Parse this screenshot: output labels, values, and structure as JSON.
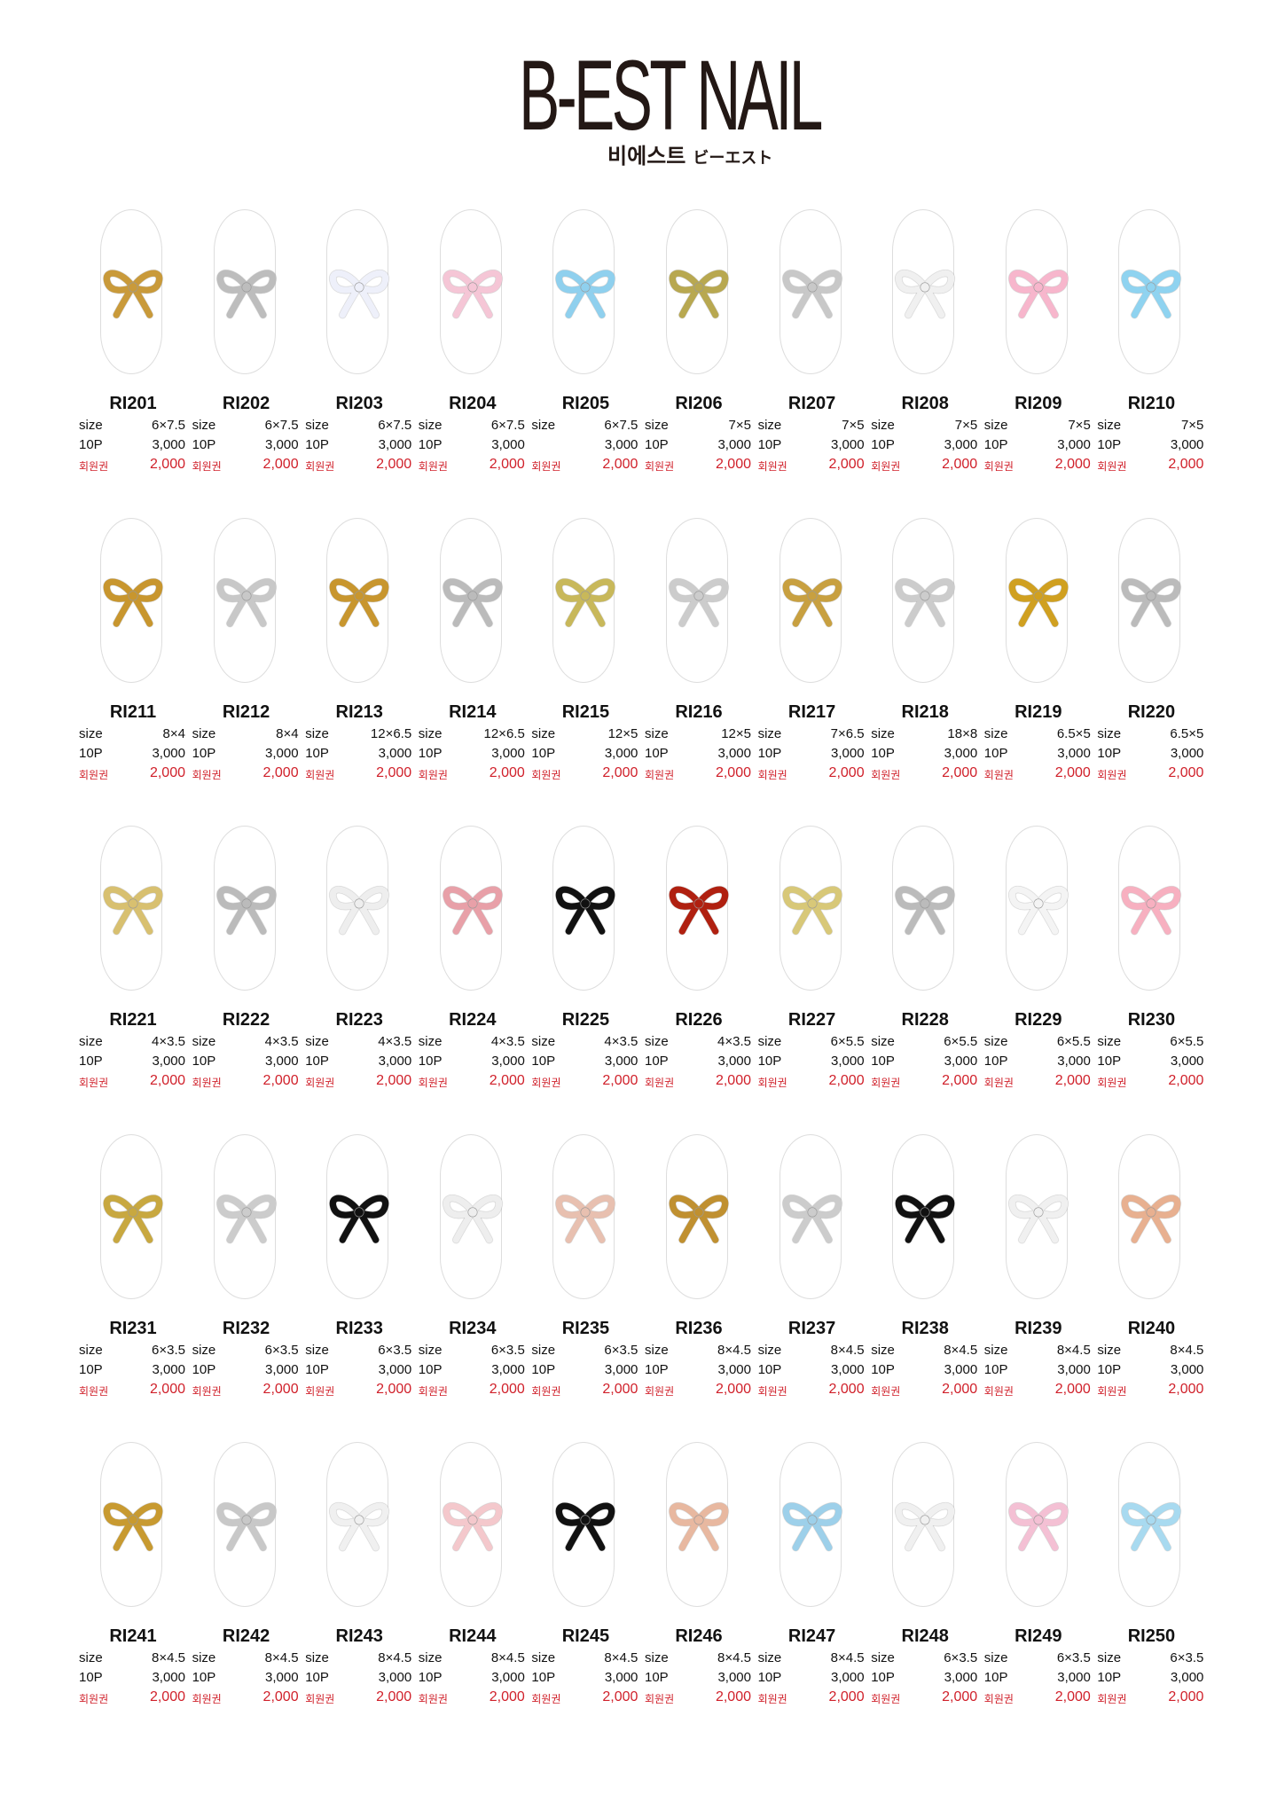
{
  "brand": {
    "name": "B-EST NAIL",
    "subtitle_ko": "비에스트",
    "subtitle_jp": "ビーエスト"
  },
  "labels": {
    "size": "size",
    "qty": "10P",
    "member": "회원권"
  },
  "items": [
    {
      "code": "RI201",
      "size": "6×7.5",
      "qty": "10P",
      "price": "3,000",
      "member_price": "2,000",
      "color": "#c99a3a"
    },
    {
      "code": "RI202",
      "size": "6×7.5",
      "qty": "10P",
      "price": "3,000",
      "member_price": "2,000",
      "color": "#bdbdbd"
    },
    {
      "code": "RI203",
      "size": "6×7.5",
      "qty": "10P",
      "price": "3,000",
      "member_price": "2,000",
      "color": "#eef0fa"
    },
    {
      "code": "RI204",
      "size": "6×7.5",
      "qty": "10P",
      "price": "3,000",
      "member_price": "2,000",
      "color": "#f5c6d6"
    },
    {
      "code": "RI205",
      "size": "6×7.5",
      "qty": "",
      "price": "3,000",
      "member_price": "2,000",
      "color": "#8fd0ee"
    },
    {
      "code": "RI206",
      "size": "7×5",
      "qty": "10P",
      "price": "3,000",
      "member_price": "2,000",
      "color": "#b8a850"
    },
    {
      "code": "RI207",
      "size": "7×5",
      "qty": "10P",
      "price": "3,000",
      "member_price": "2,000",
      "color": "#c8c8c8"
    },
    {
      "code": "RI208",
      "size": "7×5",
      "qty": "10P",
      "price": "3,000",
      "member_price": "2,000",
      "color": "#f0f0f0"
    },
    {
      "code": "RI209",
      "size": "7×5",
      "qty": "10P",
      "price": "3,000",
      "member_price": "2,000",
      "color": "#f7b6cc"
    },
    {
      "code": "RI210",
      "size": "7×5",
      "qty": "10P",
      "price": "3,000",
      "member_price": "2,000",
      "color": "#8fd3f0"
    },
    {
      "code": "RI211",
      "size": "8×4",
      "qty": "10P",
      "price": "3,000",
      "member_price": "2,000",
      "color": "#c8962e"
    },
    {
      "code": "RI212",
      "size": "8×4",
      "qty": "10P",
      "price": "3,000",
      "member_price": "2,000",
      "color": "#c8c8c8"
    },
    {
      "code": "RI213",
      "size": "12×6.5",
      "qty": "10P",
      "price": "3,000",
      "member_price": "2,000",
      "color": "#c8962e"
    },
    {
      "code": "RI214",
      "size": "12×6.5",
      "qty": "10P",
      "price": "3,000",
      "member_price": "2,000",
      "color": "#bbbbbb"
    },
    {
      "code": "RI215",
      "size": "12×5",
      "qty": "10P",
      "price": "3,000",
      "member_price": "2,000",
      "color": "#c8b85a"
    },
    {
      "code": "RI216",
      "size": "12×5",
      "qty": "10P",
      "price": "3,000",
      "member_price": "2,000",
      "color": "#cccccc"
    },
    {
      "code": "RI217",
      "size": "7×6.5",
      "qty": "10P",
      "price": "3,000",
      "member_price": "2,000",
      "color": "#c8a040"
    },
    {
      "code": "RI218",
      "size": "18×8",
      "qty": "10P",
      "price": "3,000",
      "member_price": "2,000",
      "color": "#cccccc"
    },
    {
      "code": "RI219",
      "size": "6.5×5",
      "qty": "10P",
      "price": "3,000",
      "member_price": "2,000",
      "color": "#d0a020"
    },
    {
      "code": "RI220",
      "size": "6.5×5",
      "qty": "10P",
      "price": "3,000",
      "member_price": "2,000",
      "color": "#bbbbbb"
    },
    {
      "code": "RI221",
      "size": "4×3.5",
      "qty": "10P",
      "price": "3,000",
      "member_price": "2,000",
      "color": "#d8c070"
    },
    {
      "code": "RI222",
      "size": "4×3.5",
      "qty": "10P",
      "price": "3,000",
      "member_price": "2,000",
      "color": "#bbbbbb"
    },
    {
      "code": "RI223",
      "size": "4×3.5",
      "qty": "10P",
      "price": "3,000",
      "member_price": "2,000",
      "color": "#eeeeee"
    },
    {
      "code": "RI224",
      "size": "4×3.5",
      "qty": "10P",
      "price": "3,000",
      "member_price": "2,000",
      "color": "#e8a0a8"
    },
    {
      "code": "RI225",
      "size": "4×3.5",
      "qty": "10P",
      "price": "3,000",
      "member_price": "2,000",
      "color": "#111111"
    },
    {
      "code": "RI226",
      "size": "4×3.5",
      "qty": "10P",
      "price": "3,000",
      "member_price": "2,000",
      "color": "#b02010"
    },
    {
      "code": "RI227",
      "size": "6×5.5",
      "qty": "10P",
      "price": "3,000",
      "member_price": "2,000",
      "color": "#d8c878"
    },
    {
      "code": "RI228",
      "size": "6×5.5",
      "qty": "10P",
      "price": "3,000",
      "member_price": "2,000",
      "color": "#bbbbbb"
    },
    {
      "code": "RI229",
      "size": "6×5.5",
      "qty": "10P",
      "price": "3,000",
      "member_price": "2,000",
      "color": "#f4f4f4"
    },
    {
      "code": "RI230",
      "size": "6×5.5",
      "qty": "10P",
      "price": "3,000",
      "member_price": "2,000",
      "color": "#f7b0c0"
    },
    {
      "code": "RI231",
      "size": "6×3.5",
      "qty": "10P",
      "price": "3,000",
      "member_price": "2,000",
      "color": "#c8a840"
    },
    {
      "code": "RI232",
      "size": "6×3.5",
      "qty": "10P",
      "price": "3,000",
      "member_price": "2,000",
      "color": "#cccccc"
    },
    {
      "code": "RI233",
      "size": "6×3.5",
      "qty": "10P",
      "price": "3,000",
      "member_price": "2,000",
      "color": "#111111"
    },
    {
      "code": "RI234",
      "size": "6×3.5",
      "qty": "10P",
      "price": "3,000",
      "member_price": "2,000",
      "color": "#eeeeee"
    },
    {
      "code": "RI235",
      "size": "6×3.5",
      "qty": "10P",
      "price": "3,000",
      "member_price": "2,000",
      "color": "#e8c0b0"
    },
    {
      "code": "RI236",
      "size": "8×4.5",
      "qty": "10P",
      "price": "3,000",
      "member_price": "2,000",
      "color": "#c09030"
    },
    {
      "code": "RI237",
      "size": "8×4.5",
      "qty": "10P",
      "price": "3,000",
      "member_price": "2,000",
      "color": "#cccccc"
    },
    {
      "code": "RI238",
      "size": "8×4.5",
      "qty": "10P",
      "price": "3,000",
      "member_price": "2,000",
      "color": "#111111"
    },
    {
      "code": "RI239",
      "size": "8×4.5",
      "qty": "10P",
      "price": "3,000",
      "member_price": "2,000",
      "color": "#f0f0f0"
    },
    {
      "code": "RI240",
      "size": "8×4.5",
      "qty": "10P",
      "price": "3,000",
      "member_price": "2,000",
      "color": "#e8b090"
    },
    {
      "code": "RI241",
      "size": "8×4.5",
      "qty": "10P",
      "price": "3,000",
      "member_price": "2,000",
      "color": "#c89a30"
    },
    {
      "code": "RI242",
      "size": "8×4.5",
      "qty": "10P",
      "price": "3,000",
      "member_price": "2,000",
      "color": "#c8c8c8"
    },
    {
      "code": "RI243",
      "size": "8×4.5",
      "qty": "10P",
      "price": "3,000",
      "member_price": "2,000",
      "color": "#f0f0f0"
    },
    {
      "code": "RI244",
      "size": "8×4.5",
      "qty": "10P",
      "price": "3,000",
      "member_price": "2,000",
      "color": "#f4c8cc"
    },
    {
      "code": "RI245",
      "size": "8×4.5",
      "qty": "10P",
      "price": "3,000",
      "member_price": "2,000",
      "color": "#111111"
    },
    {
      "code": "RI246",
      "size": "8×4.5",
      "qty": "10P",
      "price": "3,000",
      "member_price": "2,000",
      "color": "#e8b8a0"
    },
    {
      "code": "RI247",
      "size": "8×4.5",
      "qty": "10P",
      "price": "3,000",
      "member_price": "2,000",
      "color": "#9dd0ea"
    },
    {
      "code": "RI248",
      "size": "6×3.5",
      "qty": "10P",
      "price": "3,000",
      "member_price": "2,000",
      "color": "#f0f0f0"
    },
    {
      "code": "RI249",
      "size": "6×3.5",
      "qty": "10P",
      "price": "3,000",
      "member_price": "2,000",
      "color": "#f4c0d4"
    },
    {
      "code": "RI250",
      "size": "6×3.5",
      "qty": "10P",
      "price": "3,000",
      "member_price": "2,000",
      "color": "#a8daf0"
    }
  ]
}
